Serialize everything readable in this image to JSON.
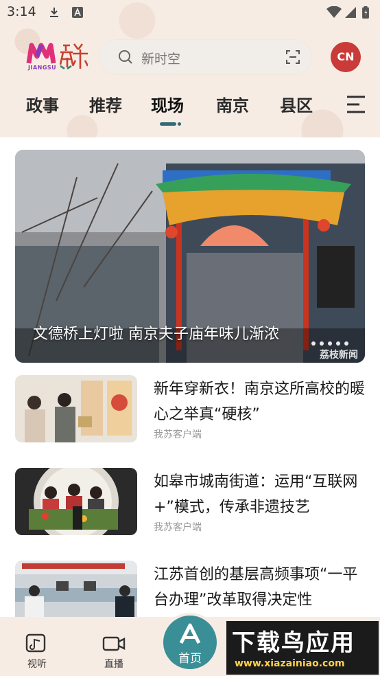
{
  "status_bar": {
    "time": "3:14"
  },
  "header": {
    "logo_text": "JIANGSU",
    "search_placeholder": "新时空",
    "avatar_label": "CN"
  },
  "tabs": [
    {
      "label": "政事"
    },
    {
      "label": "推荐"
    },
    {
      "label": "现场",
      "active": true
    },
    {
      "label": "南京"
    },
    {
      "label": "县区"
    }
  ],
  "hero": {
    "title": "文德桥上灯啦 南京夫子庙年味儿渐浓",
    "watermark": "荔枝新闻"
  },
  "news": [
    {
      "title": "新年穿新衣！南京这所高校的暖心之举真“硬核”",
      "source": "我苏客户端"
    },
    {
      "title": "如皋市城南街道：运用“互联网+”模式，传承非遗技艺",
      "source": "我苏客户端"
    },
    {
      "title": "江苏首创的基层高频事项“一平台办理”改革取得决定性",
      "source": ""
    }
  ],
  "bottom_nav": {
    "items": [
      {
        "label": "视听"
      },
      {
        "label": "直播"
      }
    ],
    "home_label": "首页"
  },
  "ad_banner": {
    "main": "下载鸟应用",
    "sub": "www.xiazainiao.com"
  },
  "colors": {
    "accent": "#2f6a77",
    "avatar_bg": "#c93a38",
    "home_bg": "#3a8f96",
    "header_bg": "#f7ece4"
  }
}
